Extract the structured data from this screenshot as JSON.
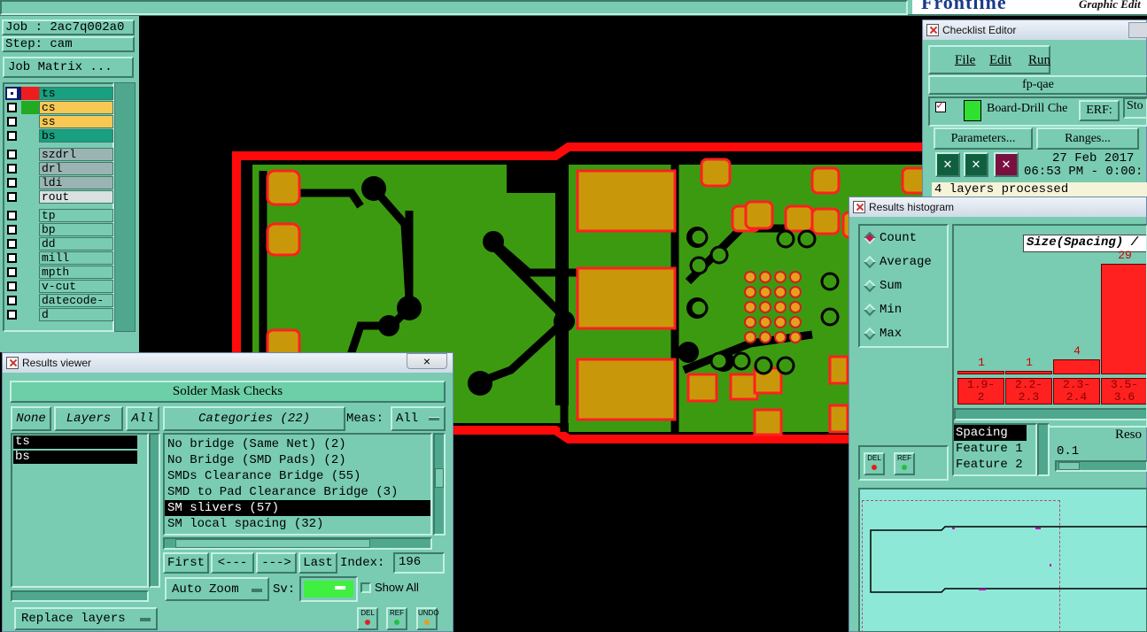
{
  "job": {
    "label": "Job : 2ac7q002a0",
    "step": "Step: cam",
    "matrix_button": "Job Matrix ..."
  },
  "brand": {
    "text": "Graphic Edit"
  },
  "layers": [
    {
      "name": "ts",
      "swatch": "#ee1c1c",
      "bg": "#18a080",
      "selected": true
    },
    {
      "name": "cs",
      "swatch": "#22aa22",
      "bg": "#f8c855"
    },
    {
      "name": "ss",
      "swatch": "#79cbb2",
      "bg": "#f8c855"
    },
    {
      "name": "bs",
      "swatch": "#79cbb2",
      "bg": "#18a080"
    },
    {
      "name": "szdrl",
      "swatch": "#79cbb2",
      "bg": "#9ab4b4"
    },
    {
      "name": "drl",
      "swatch": "#79cbb2",
      "bg": "#9ab4b4"
    },
    {
      "name": "ldi",
      "swatch": "#79cbb2",
      "bg": "#9ab4b4"
    },
    {
      "name": "rout",
      "swatch": "#79cbb2",
      "bg": "#d8e0e0"
    },
    {
      "name": "tp",
      "swatch": "#79cbb2",
      "bg": "#79cbb2"
    },
    {
      "name": "bp",
      "swatch": "#79cbb2",
      "bg": "#79cbb2"
    },
    {
      "name": "dd",
      "swatch": "#79cbb2",
      "bg": "#79cbb2"
    },
    {
      "name": "mill",
      "swatch": "#79cbb2",
      "bg": "#79cbb2"
    },
    {
      "name": "mpth",
      "swatch": "#79cbb2",
      "bg": "#79cbb2"
    },
    {
      "name": "v-cut",
      "swatch": "#79cbb2",
      "bg": "#79cbb2"
    },
    {
      "name": "datecode-ts",
      "swatch": "#79cbb2",
      "bg": "#79cbb2"
    },
    {
      "name": "d",
      "swatch": "#79cbb2",
      "bg": "#79cbb2"
    }
  ],
  "results_viewer": {
    "title": "Results viewer",
    "close": "×",
    "banner": "Solder Mask Checks",
    "none_btn": "None",
    "layers_btn": "Layers",
    "all_btn": "All",
    "layer_list": [
      "ts",
      "bs"
    ],
    "categories_btn": "Categories (22)",
    "meas_label": "Meas:",
    "meas_value": "All",
    "categories": [
      "No bridge (Same Net) (2)",
      "No Bridge (SMD Pads) (2)",
      "SMDs Clearance Bridge (55)",
      "SMD to Pad Clearance Bridge (3)",
      "SM slivers (57)",
      "SM local spacing (32)"
    ],
    "selected_category_index": 4,
    "first_btn": "First",
    "prev_btn": "<---",
    "next_btn": "--->",
    "last_btn": "Last",
    "index_label": "Index:",
    "index_value": "196",
    "auto_zoom": "Auto Zoom",
    "sv_label": "Sv:",
    "show_all": "Show All",
    "replace_layers": "Replace layers",
    "del": "DEL",
    "ref": "REF",
    "undo": "UNDO"
  },
  "checklist": {
    "title": "Checklist Editor",
    "menu": [
      "File",
      "Edit",
      "Run"
    ],
    "name": "fp-qae",
    "action": "Board-Drill Che",
    "erf": "ERF:",
    "sto": "Sto",
    "parameters": "Parameters...",
    "ranges": "Ranges...",
    "date": "27 Feb 2017",
    "time": "06:53 PM - 0:00:",
    "status": "4 layers processed"
  },
  "histogram": {
    "title": "Results histogram",
    "options": [
      "Count",
      "Average",
      "Sum",
      "Min",
      "Max"
    ],
    "selected_option": "Count",
    "chart_title": "Size(Spacing) /",
    "bars": [
      {
        "label": "1.9-\n2",
        "count": 1
      },
      {
        "label": "2.2-\n2.3",
        "count": 1
      },
      {
        "label": "2.3-\n2.4",
        "count": 4
      },
      {
        "label": "3.5-\n3.6",
        "count": 29
      }
    ],
    "fields": [
      "Spacing",
      "Feature 1",
      "Feature 2"
    ],
    "reso_label": "Reso",
    "reso_value": "0.1",
    "del": "DEL",
    "ref": "REF"
  }
}
